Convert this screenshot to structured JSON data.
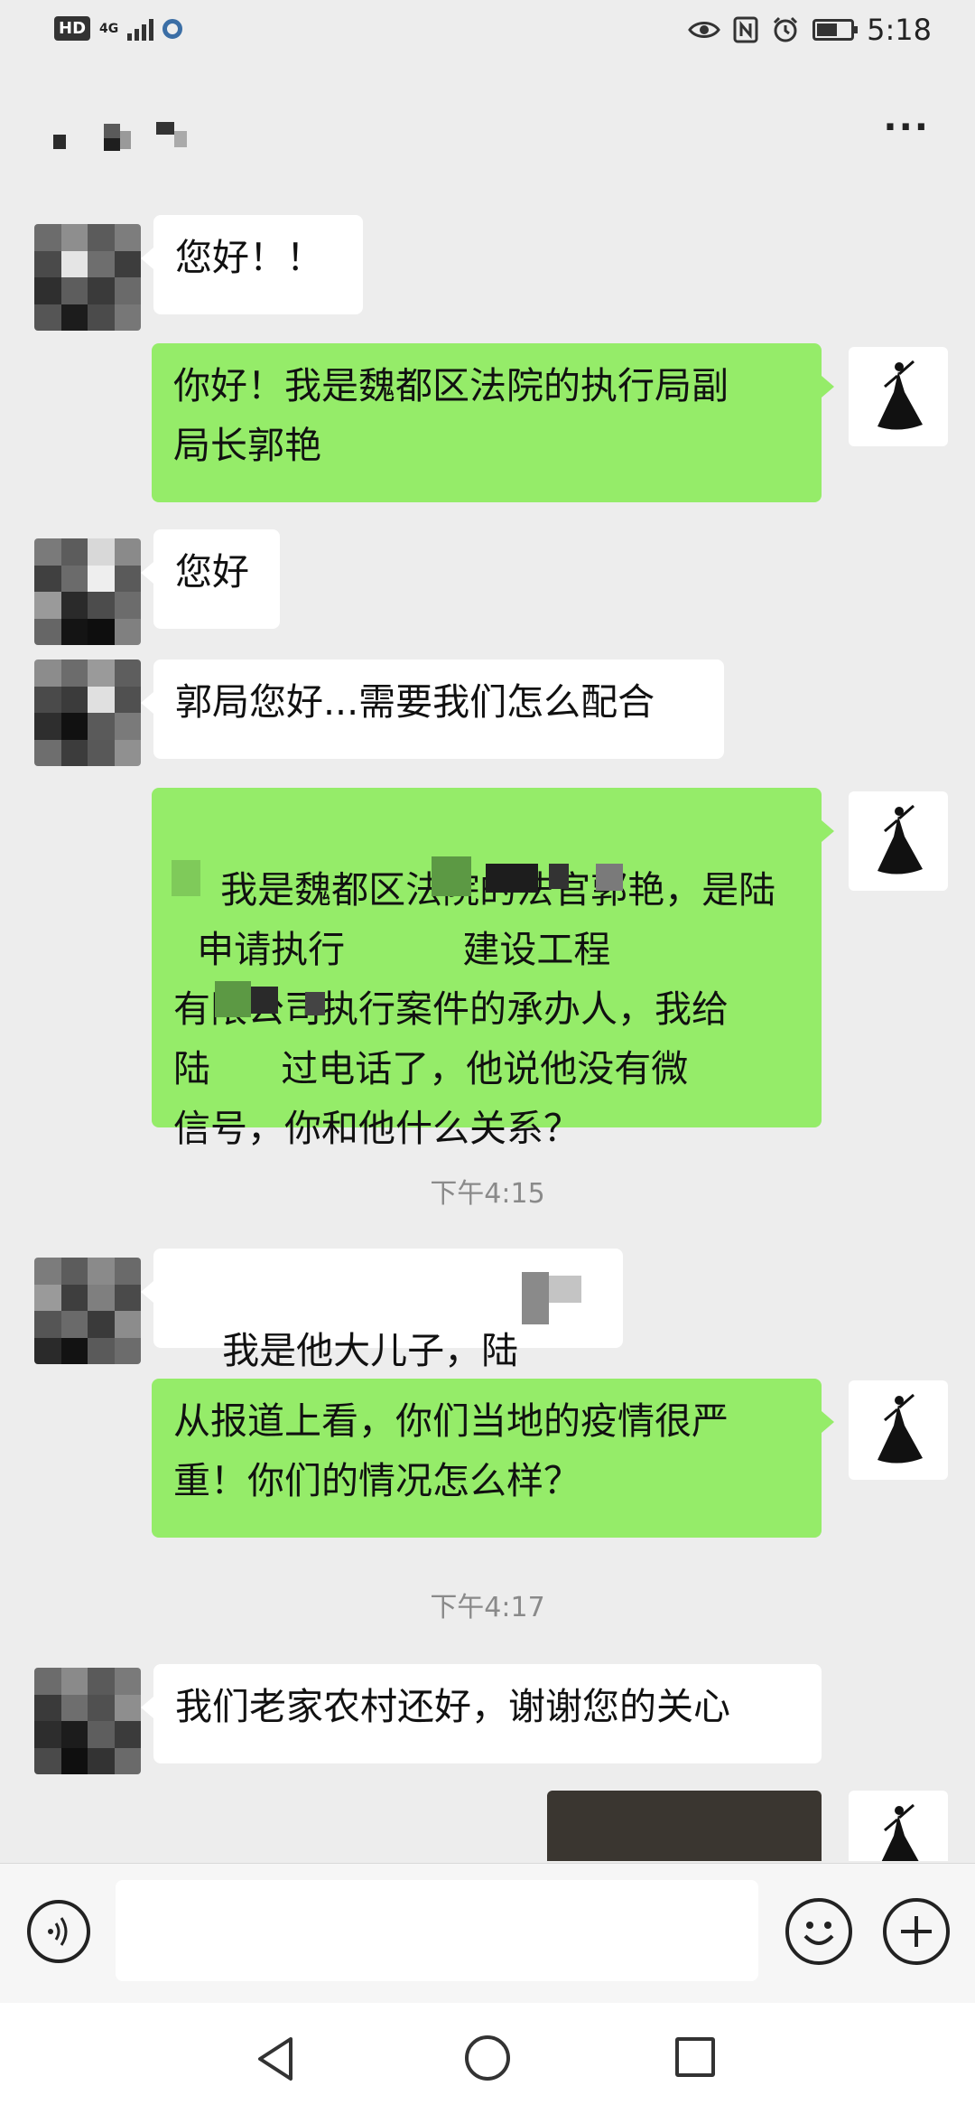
{
  "status_bar": {
    "hd_badge": "HD",
    "network": "4G",
    "time": "5:18",
    "icons": [
      "eye-icon",
      "nfc-icon",
      "alarm-icon",
      "battery-icon"
    ]
  },
  "header": {
    "title_redacted": true,
    "more_icon": "more-icon",
    "more_label": "···"
  },
  "messages": [
    {
      "side": "left",
      "text": "您好！！"
    },
    {
      "side": "right",
      "text": "你好！我是魏都区法院的执行局副\n局长郭艳"
    },
    {
      "side": "left",
      "text": "您好"
    },
    {
      "side": "left",
      "text": "郭局您好...需要我们怎么配合"
    },
    {
      "side": "right",
      "text": "我是魏都区法院的法官郭艳，是陆\n  申请执行          建设工程\n有限公司执行案件的承办人，我给\n陆      过电话了，他说他没有微\n信号，你和他什么关系？",
      "partially_redacted": true
    },
    {
      "side": "time",
      "text": "下午4:15"
    },
    {
      "side": "left",
      "text": "我是他大儿子，陆",
      "partially_redacted": true
    },
    {
      "side": "right",
      "text": "从报道上看，你们当地的疫情很严\n重！你们的情况怎么样？"
    },
    {
      "side": "time",
      "text": "下午4:17"
    },
    {
      "side": "left",
      "text": "我们老家农村还好，谢谢您的关心"
    },
    {
      "side": "right",
      "type": "image",
      "text": ""
    }
  ],
  "input_bar": {
    "placeholder": "",
    "voice_icon": "voice-icon",
    "emoji_icon": "emoji-icon",
    "add_icon": "plus-icon"
  },
  "nav_bar": {
    "icons": [
      "back-icon",
      "home-icon",
      "recent-apps-icon"
    ]
  },
  "colors": {
    "background": "#ededed",
    "sent_bubble": "#95ec69",
    "received_bubble": "#ffffff",
    "timestamp": "#8a8a8a"
  }
}
